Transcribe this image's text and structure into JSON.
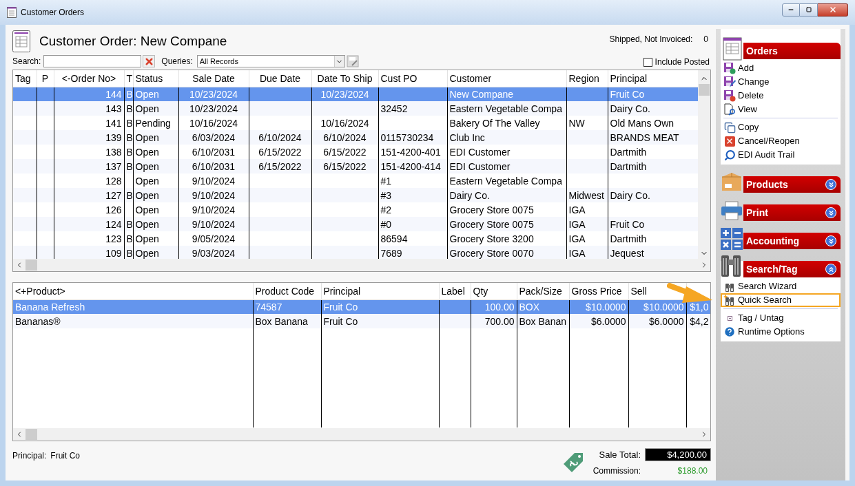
{
  "window": {
    "title": "Customer Orders"
  },
  "header": {
    "title": "Customer Order: New Compane",
    "shipped_label": "Shipped, Not Invoiced:",
    "shipped_value": "0"
  },
  "search": {
    "label": "Search:"
  },
  "queries": {
    "label": "Queries:",
    "value": "All Records"
  },
  "include_posted": {
    "label": "Include Posted",
    "checked": false
  },
  "orders_table": {
    "columns": [
      "Tag",
      "P",
      "<-Order No>",
      "T",
      "Status",
      "Sale Date",
      "Due Date",
      "Date To Ship",
      "Cust PO",
      "Customer",
      "Region",
      "Principal"
    ],
    "rows": [
      {
        "selected": true,
        "cells": [
          "",
          "",
          "144",
          "B",
          "Open",
          "10/23/2024",
          "",
          "10/23/2024",
          "",
          "New Compane",
          "",
          "Fruit Co"
        ]
      },
      {
        "selected": false,
        "cells": [
          "",
          "",
          "143",
          "B",
          "Open",
          "10/23/2024",
          "",
          "",
          "32452",
          "Eastern Vegetable Compa",
          "",
          "Dairy Co."
        ]
      },
      {
        "selected": false,
        "cells": [
          "",
          "",
          "141",
          "B",
          "Pending",
          "10/16/2024",
          "",
          "10/16/2024",
          "",
          "Bakery Of The Valley",
          "NW",
          "Old Mans Own"
        ]
      },
      {
        "selected": false,
        "cells": [
          "",
          "",
          "139",
          "B",
          "Open",
          "6/03/2024",
          "6/10/2024",
          "6/10/2024",
          "0115730234",
          "Club Inc",
          "",
          "BRANDS MEAT"
        ]
      },
      {
        "selected": false,
        "cells": [
          "",
          "",
          "138",
          "B",
          "Open",
          "6/10/2031",
          "6/15/2022",
          "6/15/2022",
          "151-4200-401",
          "EDI Customer",
          "",
          "Dartmith"
        ]
      },
      {
        "selected": false,
        "cells": [
          "",
          "",
          "137",
          "B",
          "Open",
          "6/10/2031",
          "6/15/2022",
          "6/15/2022",
          "151-4200-414",
          "EDI Customer",
          "",
          "Dartmith"
        ]
      },
      {
        "selected": false,
        "cells": [
          "",
          "",
          "128",
          "",
          "Open",
          "9/10/2024",
          "",
          "",
          "#1",
          "Eastern Vegetable Compa",
          "",
          ""
        ]
      },
      {
        "selected": false,
        "cells": [
          "",
          "",
          "127",
          "B",
          "Open",
          "9/10/2024",
          "",
          "",
          "#3",
          "Dairy Co.",
          "Midwest",
          "Dairy Co."
        ]
      },
      {
        "selected": false,
        "cells": [
          "",
          "",
          "126",
          "",
          "Open",
          "9/10/2024",
          "",
          "",
          "#2",
          "Grocery Store 0075",
          "IGA",
          ""
        ]
      },
      {
        "selected": false,
        "cells": [
          "",
          "",
          "124",
          "B",
          "Open",
          "9/10/2024",
          "",
          "",
          "#0",
          "Grocery Store 0075",
          "IGA",
          "Fruit Co"
        ]
      },
      {
        "selected": false,
        "cells": [
          "",
          "",
          "123",
          "B",
          "Open",
          "9/05/2024",
          "",
          "",
          "86594",
          "Grocery Store 3200",
          "IGA",
          "Dartmith"
        ]
      },
      {
        "selected": false,
        "cells": [
          "",
          "",
          "109",
          "B",
          "Open",
          "9/03/2024",
          "",
          "",
          "7689",
          "Grocery Store 0070",
          "IGA",
          "Jequest"
        ]
      }
    ]
  },
  "products_table": {
    "columns": [
      "<+Product>",
      "Product Code",
      "Principal",
      "Label",
      "Qty",
      "Pack/Size",
      "Gross Price",
      "Sell"
    ],
    "rows": [
      {
        "selected": true,
        "cells": [
          "Banana Refresh",
          "74587",
          "Fruit Co",
          "",
          "100.00",
          "BOX",
          "$10.0000",
          "$10.0000",
          "$1,0"
        ]
      },
      {
        "selected": false,
        "cells": [
          "Bananas®",
          "Box Banana",
          "Fruit Co",
          "",
          "700.00",
          "Box Banan",
          "$6.0000",
          "$6.0000",
          "$4,2"
        ]
      }
    ]
  },
  "footer": {
    "principal_label": "Principal:",
    "principal_value": "Fruit Co",
    "sale_total_label": "Sale Total:",
    "sale_total": "$4,200.00",
    "commission_label": "Commission:",
    "commission": "$188.00"
  },
  "sidebar": {
    "sections": [
      {
        "title": "Orders",
        "expanded": true,
        "groups": [
          [
            {
              "label": "Add",
              "highlighted": false
            },
            {
              "label": "Change",
              "highlighted": false
            },
            {
              "label": "Delete",
              "highlighted": false
            },
            {
              "label": "View",
              "highlighted": false
            }
          ],
          [
            {
              "label": "Copy",
              "highlighted": false
            },
            {
              "label": "Cancel/Reopen",
              "highlighted": false
            },
            {
              "label": "EDI Audit Trail",
              "highlighted": false
            }
          ]
        ]
      },
      {
        "title": "Products",
        "expanded": false
      },
      {
        "title": "Print",
        "expanded": false
      },
      {
        "title": "Accounting",
        "expanded": false
      },
      {
        "title": "Search/Tag",
        "expanded": true,
        "groups": [
          [
            {
              "label": "Search Wizard",
              "highlighted": false
            },
            {
              "label": "Quick Search",
              "highlighted": true
            }
          ],
          [
            {
              "label": "Tag / Untag",
              "highlighted": false
            },
            {
              "label": "Runtime Options",
              "highlighted": false
            }
          ]
        ]
      }
    ]
  }
}
